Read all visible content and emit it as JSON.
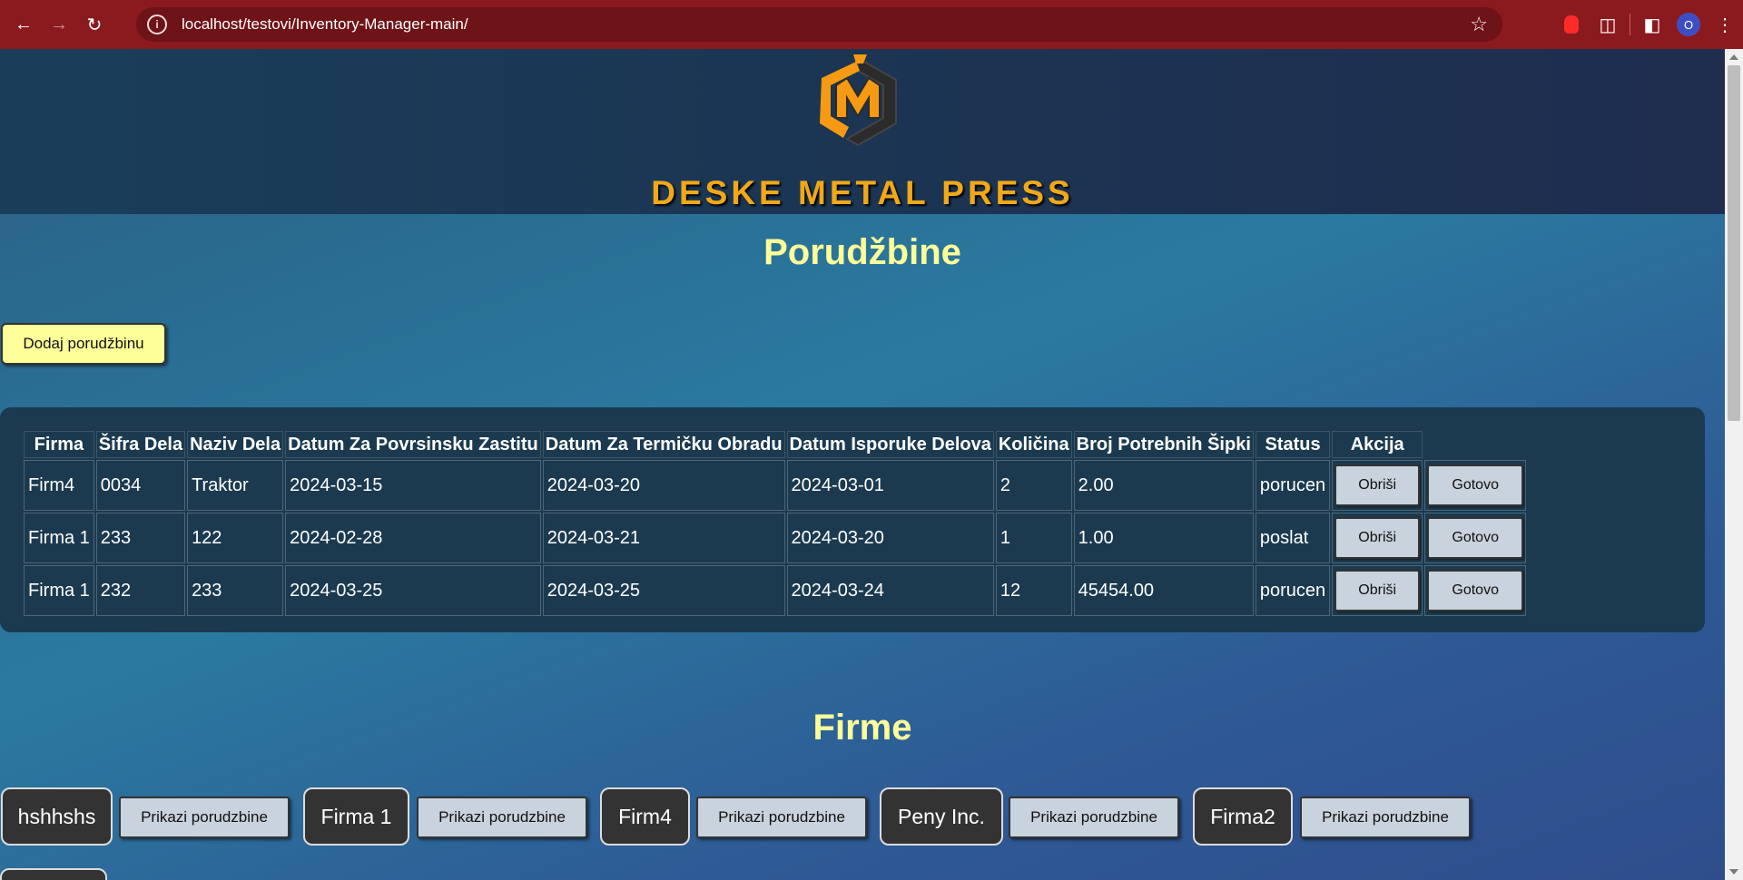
{
  "browser": {
    "url": "localhost/testovi/Inventory-Manager-main/",
    "profile_initial": "O"
  },
  "header": {
    "brand": "DESKE METAL PRESS"
  },
  "orders": {
    "title": "Porudžbine",
    "add_button": "Dodaj porudžbinu",
    "columns": [
      "Firma",
      "Šifra Dela",
      "Naziv Dela",
      "Datum Za Povrsinsku Zastitu",
      "Datum Za Termičku Obradu",
      "Datum Isporuke Delova",
      "Količina",
      "Broj Potrebnih Šipki",
      "Status",
      "Akcija"
    ],
    "rows": [
      {
        "firma": "Firm4",
        "sifra": "0034",
        "naziv": "Traktor",
        "povrsinska": "2024-03-15",
        "termicka": "2024-03-20",
        "isporuka": "2024-03-01",
        "kolicina": "2",
        "sipke": "2.00",
        "status": "porucen",
        "delete": "Obriši",
        "done": "Gotovo"
      },
      {
        "firma": "Firma 1",
        "sifra": "233",
        "naziv": "122",
        "povrsinska": "2024-02-28",
        "termicka": "2024-03-21",
        "isporuka": "2024-03-20",
        "kolicina": "1",
        "sipke": "1.00",
        "status": "poslat",
        "delete": "Obriši",
        "done": "Gotovo"
      },
      {
        "firma": "Firma 1",
        "sifra": "232",
        "naziv": "233",
        "povrsinska": "2024-03-25",
        "termicka": "2024-03-25",
        "isporuka": "2024-03-24",
        "kolicina": "12",
        "sipke": "45454.00",
        "status": "porucen",
        "delete": "Obriši",
        "done": "Gotovo"
      }
    ]
  },
  "companies": {
    "title": "Firme",
    "show_label": "Prikazi porudzbine",
    "items": [
      {
        "name": "hshhshs"
      },
      {
        "name": "Firma 1"
      },
      {
        "name": "Firm4"
      },
      {
        "name": "Peny Inc."
      },
      {
        "name": "Firma2"
      }
    ]
  },
  "colors": {
    "chrome": "#8b1a1e",
    "title_yellow": "#ffff99",
    "brand_orange": "#f0a818",
    "panel": "#1b3a4f"
  }
}
